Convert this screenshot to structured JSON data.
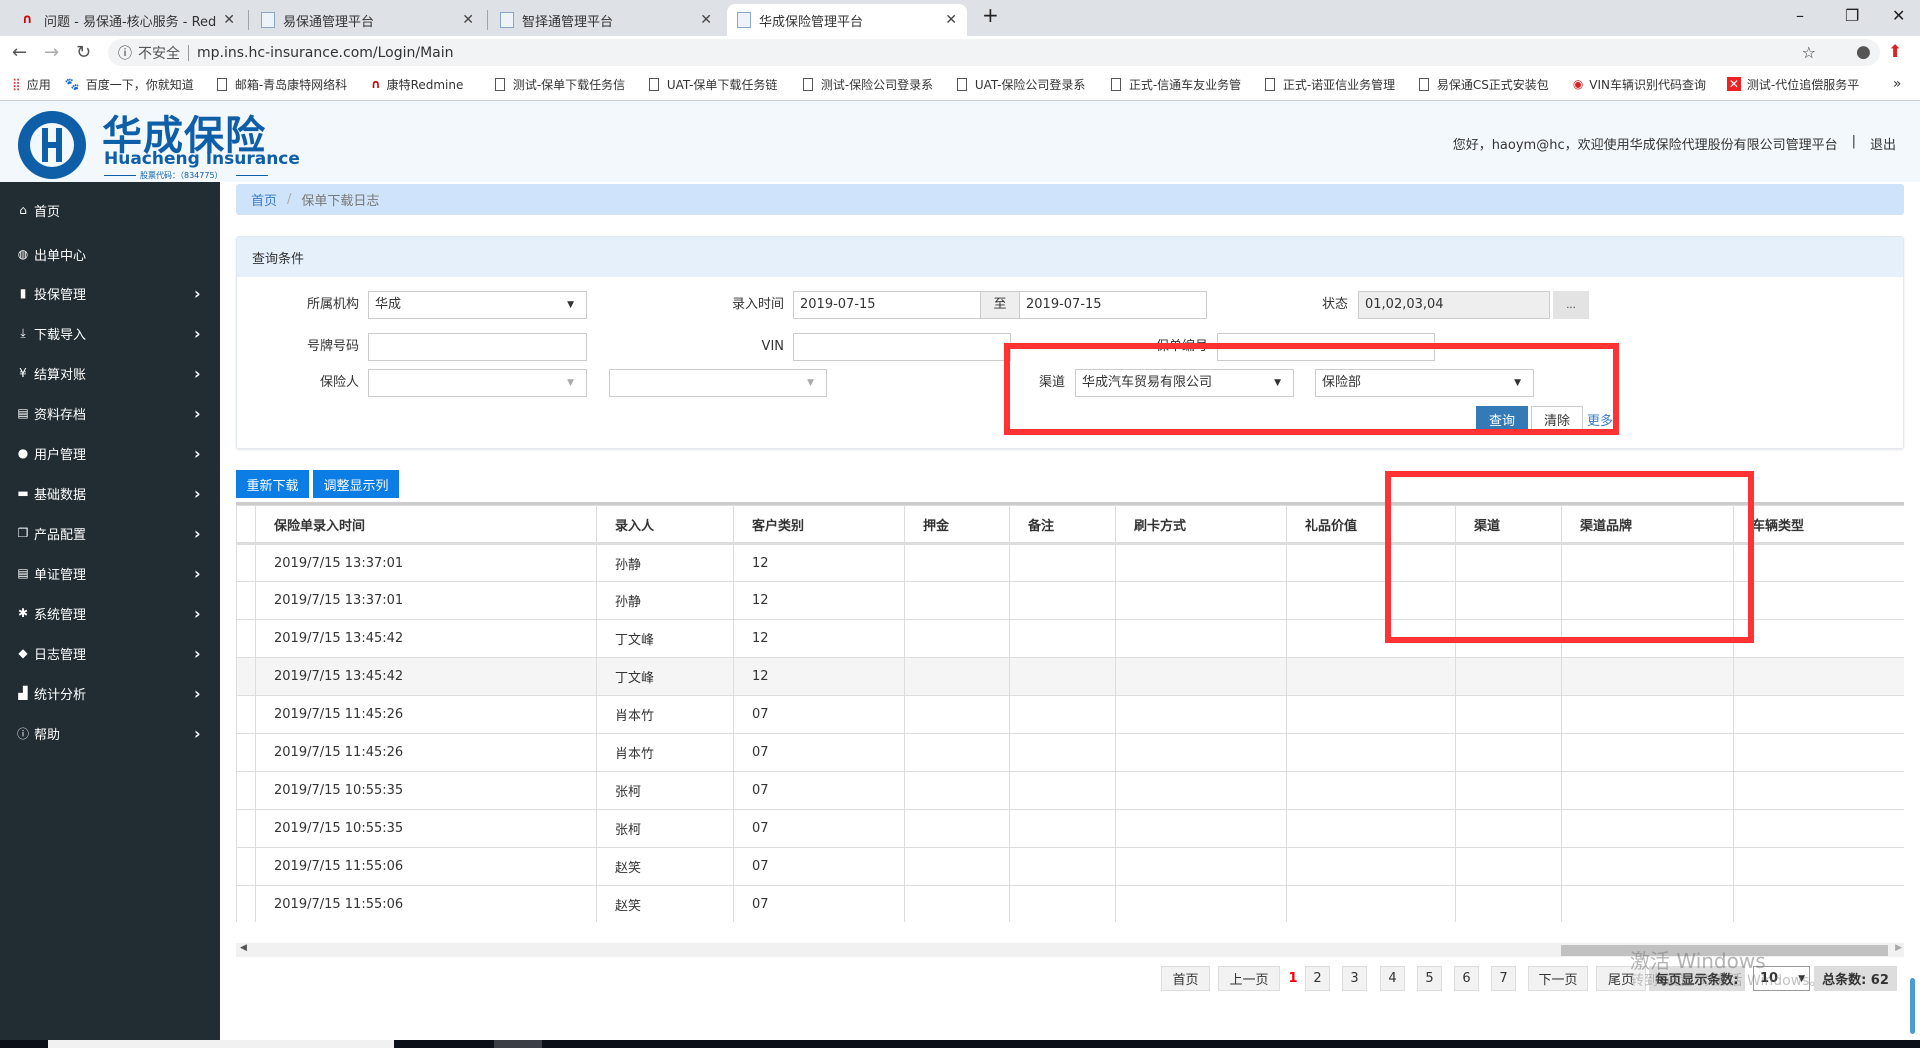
{
  "browser": {
    "tabs": [
      {
        "label": "问题 - 易保通-核心服务 - Redmine",
        "active": false
      },
      {
        "label": "易保通管理平台",
        "active": false
      },
      {
        "label": "智择通管理平台",
        "active": false
      },
      {
        "label": "华成保险管理平台",
        "active": true
      }
    ],
    "security_label": "不安全",
    "url": "mp.ins.hc-insurance.com/Login/Main",
    "bookmarks": [
      "应用",
      "百度一下，你就知道",
      "邮箱-青岛康特网络科",
      "康特Redmine",
      "测试-保单下载任务信",
      "UAT-保单下载任务链",
      "测试-保险公司登录系",
      "UAT-保险公司登录系",
      "正式-信通车友业务管",
      "正式-诺亚信业务管理",
      "易保通CS正式安装包",
      "VIN车辆识别代码查询",
      "测试-代位追偿服务平"
    ],
    "more_bookmarks": "»"
  },
  "header": {
    "logo_cn": "华成保险",
    "logo_en": "Huacheng Insurance",
    "stock_code": "股票代码：（834775）",
    "welcome": "您好，haoym@hc，欢迎使用华成保险代理股份有限公司管理平台",
    "logout": "退出"
  },
  "sidebar": {
    "items": [
      {
        "label": "首页",
        "icon": "home-icon",
        "sub": false
      },
      {
        "label": "出单中心",
        "icon": "globe-icon",
        "sub": false
      },
      {
        "label": "投保管理",
        "icon": "file-icon",
        "sub": true
      },
      {
        "label": "下载导入",
        "icon": "download-icon",
        "sub": true
      },
      {
        "label": "结算对账",
        "icon": "yen-icon",
        "sub": true
      },
      {
        "label": "资料存档",
        "icon": "list-icon",
        "sub": true
      },
      {
        "label": "用户管理",
        "icon": "user-icon",
        "sub": true
      },
      {
        "label": "基础数据",
        "icon": "hdd-icon",
        "sub": true
      },
      {
        "label": "产品配置",
        "icon": "copy-icon",
        "sub": true
      },
      {
        "label": "单证管理",
        "icon": "list-icon",
        "sub": true
      },
      {
        "label": "系统管理",
        "icon": "gear-icon",
        "sub": true
      },
      {
        "label": "日志管理",
        "icon": "tags-icon",
        "sub": true
      },
      {
        "label": "统计分析",
        "icon": "bar-chart-icon",
        "sub": true
      },
      {
        "label": "帮助",
        "icon": "info-icon",
        "sub": true
      }
    ]
  },
  "breadcrumb": {
    "home": "首页",
    "sep": "/",
    "current": "保单下载日志"
  },
  "query": {
    "title": "查询条件",
    "org_label": "所属机构",
    "org_value": "华成",
    "date_label": "录入时间",
    "date_from": "2019-07-15",
    "date_to_sep": "至",
    "date_to": "2019-07-15",
    "status_label": "状态",
    "status_value": "01,02,03,04",
    "status_btn": "...",
    "plate_label": "号牌号码",
    "plate_value": "",
    "vin_label": "VIN",
    "vin_value": "",
    "policy_label": "保单编号",
    "policy_value": "",
    "insurer_label": "保险人",
    "insurer_value": "",
    "insurer2_value": "",
    "channel_label": "渠道",
    "channel_value": "华成汽车贸易有限公司",
    "channel2_value": "保险部",
    "search_btn": "查询",
    "clear_btn": "清除",
    "more_link": "更多"
  },
  "actions": {
    "redownload": "重新下载",
    "adjust_columns": "调整显示列"
  },
  "table": {
    "columns": [
      "保险单录入时间",
      "录入人",
      "客户类别",
      "押金",
      "备注",
      "刷卡方式",
      "礼品价值",
      "渠道",
      "渠道品牌",
      "车辆类型"
    ],
    "rows": [
      [
        "2019/7/15 13:37:01",
        "孙静",
        "12"
      ],
      [
        "2019/7/15 13:37:01",
        "孙静",
        "12"
      ],
      [
        "2019/7/15 13:45:42",
        "丁文峰",
        "12"
      ],
      [
        "2019/7/15 13:45:42",
        "丁文峰",
        "12"
      ],
      [
        "2019/7/15 11:45:26",
        "肖本竹",
        "07"
      ],
      [
        "2019/7/15 11:45:26",
        "肖本竹",
        "07"
      ],
      [
        "2019/7/15 10:55:35",
        "张柯",
        "07"
      ],
      [
        "2019/7/15 10:55:35",
        "张柯",
        "07"
      ],
      [
        "2019/7/15 11:55:06",
        "赵笑",
        "07"
      ],
      [
        "2019/7/15 11:55:06",
        "赵笑",
        "07"
      ]
    ],
    "highlighted_row": 3
  },
  "pagination": {
    "first": "首页",
    "prev": "上一页",
    "pages": [
      "1",
      "2",
      "3",
      "4",
      "5",
      "6",
      "7"
    ],
    "current": "1",
    "next": "下一页",
    "last": "尾页",
    "page_size_label": "每页显示条数:",
    "page_size": "10",
    "total": "总条数: 62"
  },
  "watermark": {
    "line1": "激活 Windows",
    "line2": "转到“设置”以激活 Windows。"
  },
  "colors": {
    "sidebar": "#222d33",
    "primary": "#0b7de4",
    "highlight_box": "#ff3333",
    "current_page": "#ff0000"
  }
}
